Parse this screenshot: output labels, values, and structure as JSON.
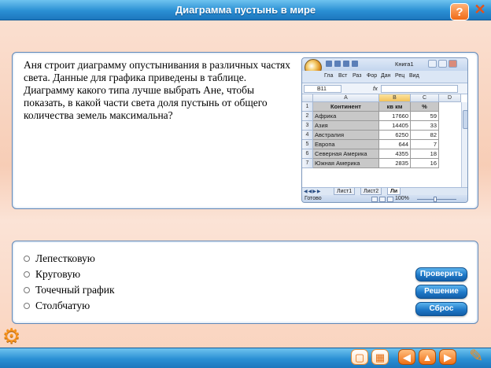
{
  "window": {
    "title": "Диаграмма пустынь в мире",
    "help_icon": "question-mark-icon",
    "close_icon": "close-x-icon",
    "help_label": "?",
    "close_label": "✕"
  },
  "question": {
    "text": "Аня строит диаграмму опустынивания в различных частях света. Данные для графика приведены в таблице. Диаграмму какого типа лучше выбрать Ане, чтобы показать, в какой части света доля пустынь от общего количества земель максимальна?"
  },
  "excel": {
    "book_name": "Книга1",
    "ribbon_tabs": [
      "Гла",
      "Вст",
      "Раз",
      "Фор",
      "Дан",
      "Рец",
      "Вид"
    ],
    "name_box": "B11",
    "fx_label": "fx",
    "columns": [
      "A",
      "B",
      "C",
      "D"
    ],
    "rows": [
      "1",
      "2",
      "3",
      "4",
      "5",
      "6",
      "7"
    ],
    "header": [
      "Континент",
      "кв км",
      "%"
    ],
    "data": [
      {
        "name": "Африка",
        "area": "17660",
        "pct": "59"
      },
      {
        "name": "Азия",
        "area": "14405",
        "pct": "33"
      },
      {
        "name": "Австралия",
        "area": "6250",
        "pct": "82"
      },
      {
        "name": "Европа",
        "area": "644",
        "pct": "7"
      },
      {
        "name": "Северная Америка",
        "area": "4355",
        "pct": "18"
      },
      {
        "name": "Южная Америка",
        "area": "2835",
        "pct": "16"
      }
    ],
    "sheet_tabs": [
      "Лист1",
      "Лист2",
      "Ли"
    ],
    "status": "Готово",
    "zoom": "100%"
  },
  "answers": [
    {
      "label": "Лепестковую"
    },
    {
      "label": "Круговую"
    },
    {
      "label": "Точечный график"
    },
    {
      "label": "Столбчатую"
    }
  ],
  "buttons": {
    "check": "Проверить",
    "solution": "Решение",
    "reset": "Сброс"
  },
  "colors": {
    "accent": "#1f79c8",
    "bar": "#2a8fd4",
    "background": "#f7cdb6",
    "nav_orange": "#f07014"
  }
}
